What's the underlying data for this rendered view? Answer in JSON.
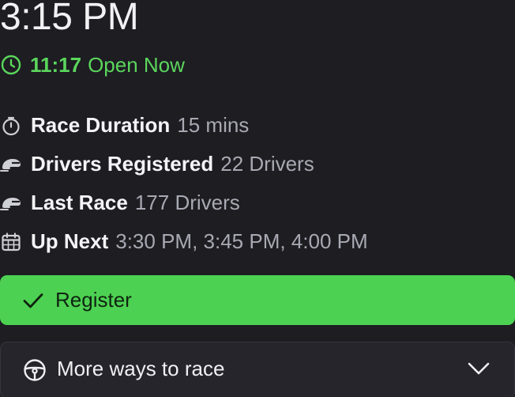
{
  "race": {
    "time": "3:15 PM",
    "countdown": "11:17",
    "status": "Open Now"
  },
  "info": {
    "rows": [
      {
        "icon": "stopwatch-icon",
        "label": "Race Duration",
        "value": "15 mins"
      },
      {
        "icon": "helmet-icon",
        "label": "Drivers Registered",
        "value": "22 Drivers"
      },
      {
        "icon": "helmet-icon",
        "label": "Last Race",
        "value": "177 Drivers"
      },
      {
        "icon": "calendar-icon",
        "label": "Up Next",
        "value": "3:30 PM, 3:45 PM, 4:00 PM"
      }
    ]
  },
  "actions": {
    "register_label": "Register",
    "register_icon": "check-icon",
    "more_label": "More ways to race",
    "more_icon": "steering-wheel-icon",
    "more_chevron": "chevron-down-icon"
  },
  "colors": {
    "accent": "#4dd152",
    "status": "#5bd65c",
    "background": "#1d1d22",
    "panel": "#25252b"
  }
}
